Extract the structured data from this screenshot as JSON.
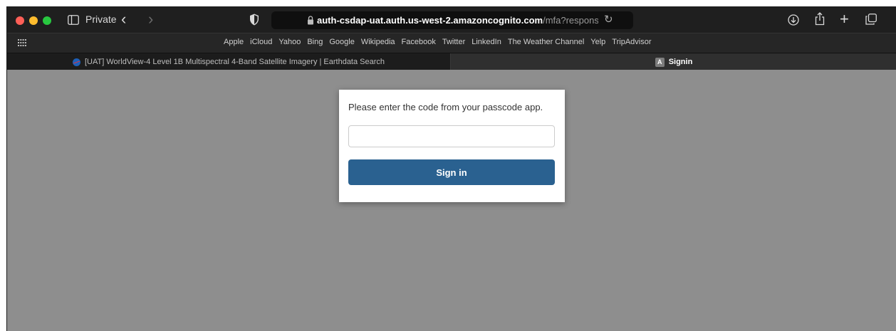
{
  "browser": {
    "private_label": "Private",
    "url_host": "auth-csdap-uat.auth.us-west-2.amazoncognito.com",
    "url_path": "/mfa?response_type=code&",
    "favorites": [
      "Apple",
      "iCloud",
      "Yahoo",
      "Bing",
      "Google",
      "Wikipedia",
      "Facebook",
      "Twitter",
      "LinkedIn",
      "The Weather Channel",
      "Yelp",
      "TripAdvisor"
    ],
    "tabs": [
      {
        "title": "[UAT] WorldView-4 Level 1B Multispectral 4-Band Satellite Imagery | Earthdata Search",
        "active": false,
        "icon": "nasa-icon"
      },
      {
        "title": "Signin",
        "active": true,
        "icon": "a-icon",
        "icon_letter": "A"
      }
    ]
  },
  "mfa": {
    "message": "Please enter the code from your passcode app.",
    "code_value": "",
    "button_label": "Sign in"
  },
  "colors": {
    "button": "#2a6190",
    "page_background": "#8e8e8e"
  }
}
